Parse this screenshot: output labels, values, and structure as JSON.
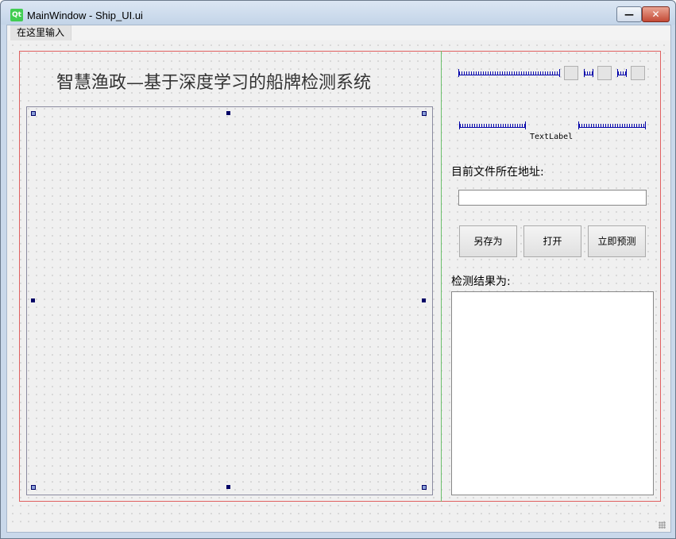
{
  "window": {
    "title": "MainWindow - Ship_UI.ui",
    "app_icon": "Qt"
  },
  "controls": {
    "minimize": "—",
    "close": "✕"
  },
  "menubar": {
    "placeholder": "在这里输入"
  },
  "main": {
    "heading": "智慧渔政—基于深度学习的船牌检测系统"
  },
  "side": {
    "text_label": "TextLabel",
    "path_label": "目前文件所在地址:",
    "path_value": "",
    "buttons": {
      "save_as": "另存为",
      "open": "打开",
      "predict": "立即预测"
    },
    "result_label": "检测结果为:",
    "result_value": ""
  },
  "colors": {
    "layout_border": "#e06060",
    "splitter": "#6bbf6b",
    "spacer": "#0000aa"
  }
}
